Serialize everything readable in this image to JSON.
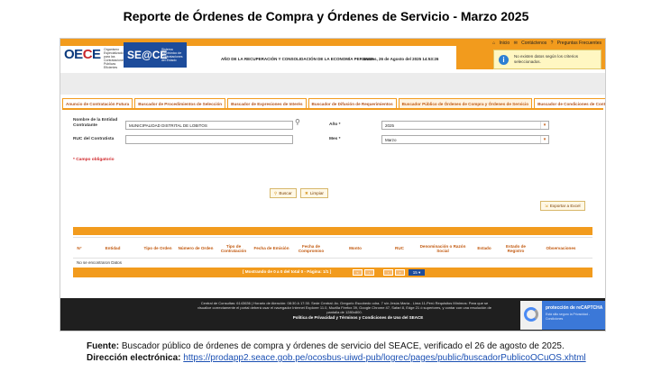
{
  "doc_title": "Reporte de Órdenes de Compra y Órdenes de Servicio - Marzo 2025",
  "header": {
    "oece_logo": "OECE",
    "oece_sub": "Organismo Especializado para las Contrataciones Públicas Eficientes",
    "seace_logo": "SE@CE",
    "seace_sub": "Sistema Electrónico de Contrataciones del Estado",
    "year_banner": "AÑO DE LA RECUPERACIÓN Y CONSOLIDACIÓN DE LA ECONOMÍA PERUANA",
    "datetime": "Martes, 26 de Agosto del 2025  14:53:26",
    "links": [
      "Inicio",
      "Contáctenos",
      "Preguntas Frecuentes"
    ],
    "alert": "No existen datos según los criterios seleccionados.",
    "alert_icon": "info-icon"
  },
  "tabs": [
    {
      "label": "Anuncio de Contratación Futura",
      "active": false
    },
    {
      "label": "Buscador de Procedimientos de Selección",
      "active": false
    },
    {
      "label": "Buscador de Expresiones de Interés",
      "active": false
    },
    {
      "label": "Buscador de Difusión de Requerimientos",
      "active": false
    },
    {
      "label": "Buscador Público de Órdenes de Compra y Órdenes de Servicio",
      "active": true
    },
    {
      "label": "Buscador de Condiciones de Contratación",
      "active": false
    }
  ],
  "form": {
    "entidad_label": "Nombre de la Entidad Contratante",
    "entidad_value": "MUNICIPALIDAD DISTRITAL DE LOBITOS",
    "ruc_label": "RUC del Contratista",
    "ruc_value": "",
    "anio_label": "Año *",
    "anio_value": "2025",
    "mes_label": "Mes *",
    "mes_value": "Marzo",
    "required_note": "* Campo obligatorio",
    "buscar": "Buscar",
    "limpiar": "Limpiar",
    "exportar": "Exportar a Excel"
  },
  "table": {
    "columns": [
      "N°",
      "Entidad",
      "Tipo de Orden",
      "Número de Orden",
      "Tipo de Contratación",
      "Fecha de Emisión",
      "Fecha de Compromiso",
      "Monto",
      "RUC",
      "Denominación o Razón Social",
      "Estado",
      "Estado de Registro",
      "Observaciones"
    ],
    "empty_message": "No se encontraron Datos",
    "pager_text": "[ Mostrando de 0 a 0 del total 0 - Página: 1/1 ]",
    "page_size": "15"
  },
  "footer": {
    "line1": "Central de Consultas: 6143636 | Horario de Atención: 08:30 A 17:30. Sede Central: Av. Gregorio Escobedo cdra. 7 s/n Jesús María - Lima 11-Perú  Requisitos Mínimos: Para que se visualice correctamente el portal deberá usar el navegador Internet Explorer 11.0, Mozilla Firefox 39, Google Chrome 47, Safari 8, Edge 21 ó superiores, y contar con una resolución de pantalla de 1280x800.",
    "privacy": "Política de Privacidad y Términos y Condiciones de Uso del SEACE",
    "captcha_title": "protección de reCAPTCHA",
    "captcha_sub": "Está sitio seguro la Privacidad - Condiciones"
  },
  "source": {
    "fuente_label": "Fuente:",
    "fuente_text": "Buscador público de órdenes de compra y órdenes de servicio del SEACE, verificado el 26 de agosto de 2025.",
    "dir_label": "Dirección electrónica:",
    "dir_url": "https://prodapp2.seace.gob.pe/ocosbus-uiwd-pub/logrec/pages/public/buscadorPublicoOCuOS.xhtml"
  },
  "colors": {
    "accent": "#f29b1d",
    "brand_blue": "#1d4c9b",
    "label_orange": "#c25a10"
  }
}
